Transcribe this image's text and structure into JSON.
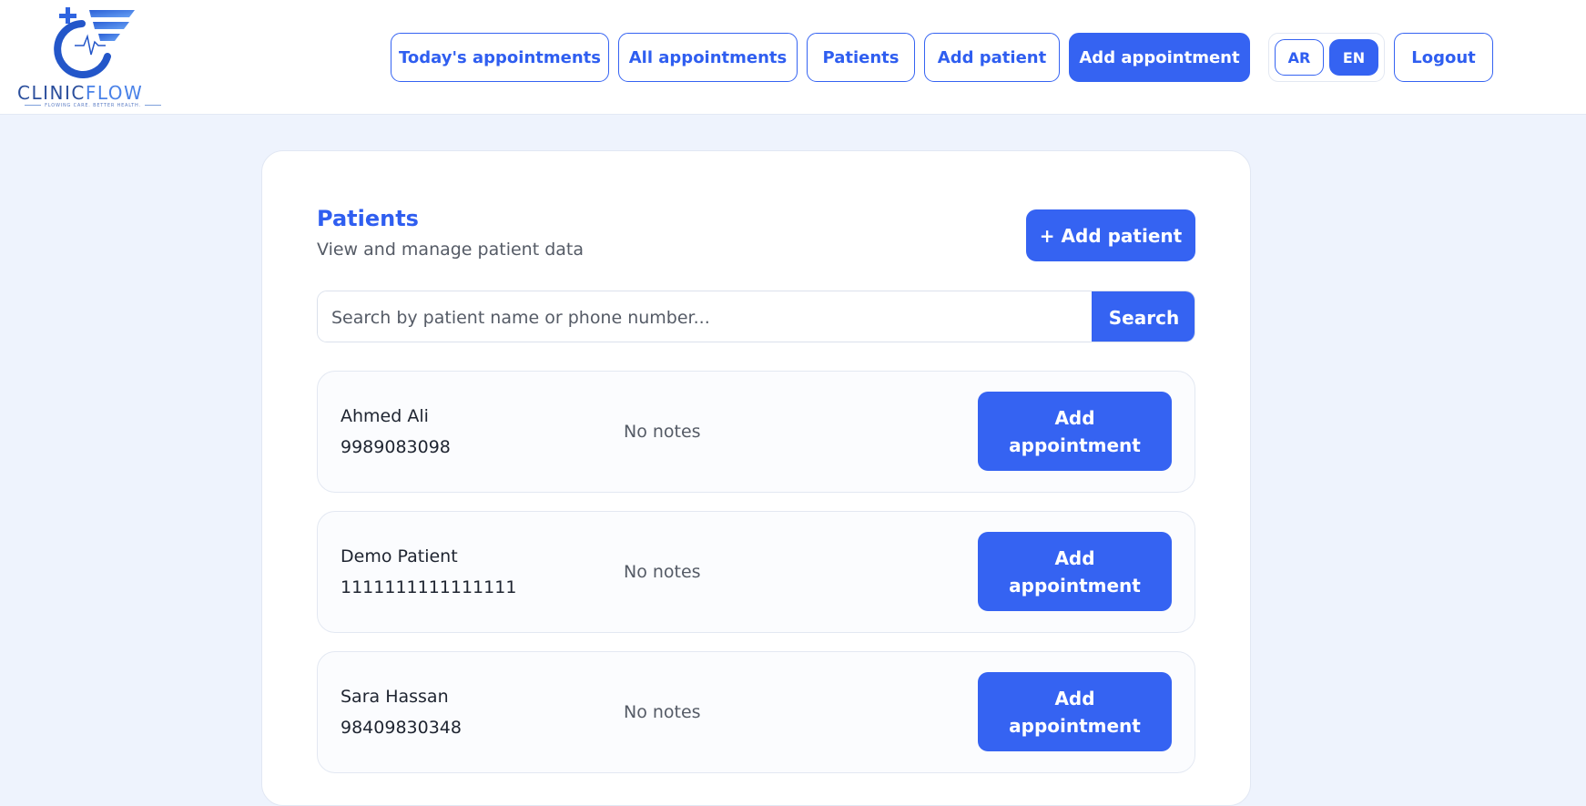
{
  "brand": {
    "name_part1": "CLINIC",
    "name_part2": "FLOW",
    "tagline": "FLOWING CARE. BETTER HEALTH."
  },
  "nav": {
    "todays_appointments": "Today's appointments",
    "all_appointments": "All appointments",
    "patients": "Patients",
    "add_patient": "Add patient",
    "add_appointment": "Add appointment",
    "lang_ar": "AR",
    "lang_en": "EN",
    "active_lang": "EN",
    "logout": "Logout"
  },
  "colors": {
    "accent": "#3563f2",
    "page_bg": "#eef3fd",
    "card_bg": "#ffffff"
  },
  "main": {
    "title": "Patients",
    "subtitle": "View and manage patient data",
    "add_patient_label": "+ Add patient",
    "search": {
      "placeholder": "Search by patient name or phone number...",
      "value": "",
      "button_label": "Search"
    },
    "patients": [
      {
        "name": "Ahmed Ali",
        "phone": "9989083098",
        "notes": "No notes",
        "action": "Add appointment"
      },
      {
        "name": "Demo Patient",
        "phone": "1111111111111111",
        "notes": "No notes",
        "action": "Add appointment"
      },
      {
        "name": "Sara Hassan",
        "phone": "98409830348",
        "notes": "No notes",
        "action": "Add appointment"
      }
    ]
  }
}
